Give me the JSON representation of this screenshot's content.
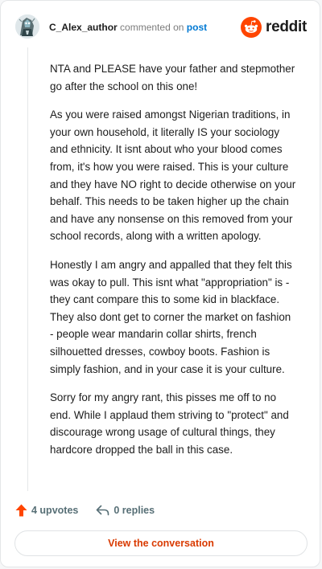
{
  "header": {
    "author": "C_Alex_author",
    "commented_on": "commented on",
    "post_link": "post",
    "brand": "reddit"
  },
  "comment": {
    "paragraphs": [
      "NTA and PLEASE have your father and stepmother go after the school on this one!",
      "As you were raised amongst Nigerian traditions, in your own household, it literally IS your sociology and ethnicity. It isnt about who your blood comes from, it's how you were raised. This is your culture and they have NO right to decide otherwise on your behalf. This needs to be taken higher up the chain and have any nonsense on this removed from your school records, along with a written apology.",
      "Honestly I am angry and appalled that they felt this was okay to pull. This isnt what \"appropriation\" is - they cant compare this to some kid in blackface. They also dont get to corner the market on fashion - people wear mandarin collar shirts, french silhouetted dresses, cowboy boots. Fashion is simply fashion, and in your case it is your culture.",
      "Sorry for my angry rant, this pisses me off to no end. While I applaud them striving to \"protect\" and discourage wrong usage of cultural things, they hardcore dropped the ball in this case."
    ]
  },
  "actions": {
    "upvotes": "4 upvotes",
    "replies": "0 replies"
  },
  "cta": {
    "label": "View the conversation"
  },
  "icons": {
    "upvote": "upvote-arrow-icon",
    "reply": "reply-arrow-icon",
    "brand": "reddit-snoo-icon",
    "avatar": "user-avatar"
  },
  "colors": {
    "brand_orange": "#ff4500",
    "link_blue": "#0079d3",
    "cta_text": "#d93a00",
    "upvote_orange": "#ff4500"
  }
}
